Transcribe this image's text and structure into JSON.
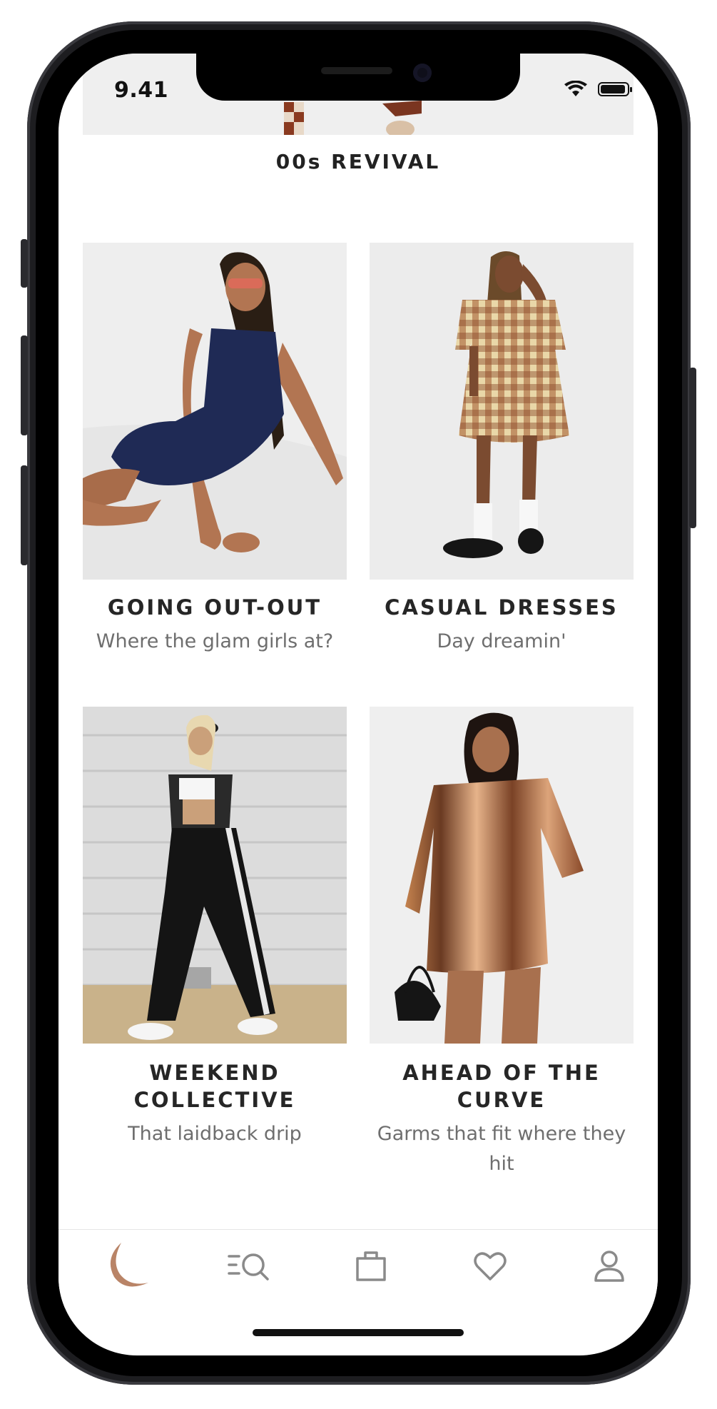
{
  "status_bar": {
    "time": "9.41"
  },
  "section": {
    "title": "00s REVIVAL"
  },
  "cards": [
    {
      "title": "GOING OUT-OUT",
      "subtitle": "Where the glam girls at?"
    },
    {
      "title": "CASUAL DRESSES",
      "subtitle": "Day dreamin'"
    },
    {
      "title": "WEEKEND COLLECTIVE",
      "subtitle": "That laidback drip"
    },
    {
      "title": "AHEAD OF THE CURVE",
      "subtitle": "Garms that fit where they hit"
    }
  ],
  "tabbar": {
    "items": [
      {
        "icon": "home-moon-icon",
        "active": true
      },
      {
        "icon": "search-icon",
        "active": false
      },
      {
        "icon": "bag-icon",
        "active": false
      },
      {
        "icon": "heart-icon",
        "active": false
      },
      {
        "icon": "account-icon",
        "active": false
      }
    ],
    "active_color": "#b98467",
    "inactive_color": "#8a8a8a"
  }
}
